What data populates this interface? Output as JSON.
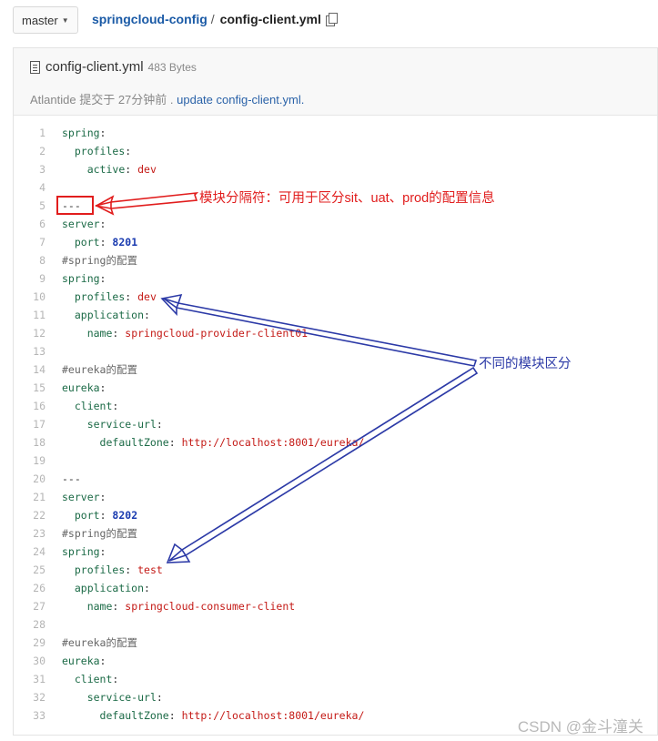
{
  "topbar": {
    "branch_label": "master",
    "repo_name": "springcloud-config",
    "separator": "/",
    "file_name": "config-client.yml"
  },
  "file_header": {
    "file_name": "config-client.yml",
    "file_size": "483 Bytes",
    "author": "Atlantide",
    "committed_text": "提交于 27分钟前 .",
    "commit_message": "update config-client.yml."
  },
  "code_lines": [
    {
      "n": "1",
      "parts": [
        {
          "t": "spring",
          "c": "k"
        },
        {
          "t": ":",
          "c": "p"
        }
      ]
    },
    {
      "n": "2",
      "parts": [
        {
          "t": "  ",
          "c": "p"
        },
        {
          "t": "profiles",
          "c": "k"
        },
        {
          "t": ":",
          "c": "p"
        }
      ]
    },
    {
      "n": "3",
      "parts": [
        {
          "t": "    ",
          "c": "p"
        },
        {
          "t": "active",
          "c": "k"
        },
        {
          "t": ": ",
          "c": "p"
        },
        {
          "t": "dev",
          "c": "v"
        }
      ]
    },
    {
      "n": "4",
      "parts": []
    },
    {
      "n": "5",
      "parts": [
        {
          "t": "---",
          "c": "p"
        }
      ]
    },
    {
      "n": "6",
      "parts": [
        {
          "t": "server",
          "c": "k"
        },
        {
          "t": ":",
          "c": "p"
        }
      ]
    },
    {
      "n": "7",
      "parts": [
        {
          "t": "  ",
          "c": "p"
        },
        {
          "t": "port",
          "c": "k"
        },
        {
          "t": ": ",
          "c": "p"
        },
        {
          "t": "8201",
          "c": "n"
        }
      ]
    },
    {
      "n": "8",
      "parts": [
        {
          "t": "#spring的配置",
          "c": "c"
        }
      ]
    },
    {
      "n": "9",
      "parts": [
        {
          "t": "spring",
          "c": "k"
        },
        {
          "t": ":",
          "c": "p"
        }
      ]
    },
    {
      "n": "10",
      "parts": [
        {
          "t": "  ",
          "c": "p"
        },
        {
          "t": "profiles",
          "c": "k"
        },
        {
          "t": ": ",
          "c": "p"
        },
        {
          "t": "dev",
          "c": "v"
        }
      ]
    },
    {
      "n": "11",
      "parts": [
        {
          "t": "  ",
          "c": "p"
        },
        {
          "t": "application",
          "c": "k"
        },
        {
          "t": ":",
          "c": "p"
        }
      ]
    },
    {
      "n": "12",
      "parts": [
        {
          "t": "    ",
          "c": "p"
        },
        {
          "t": "name",
          "c": "k"
        },
        {
          "t": ": ",
          "c": "p"
        },
        {
          "t": "springcloud-provider-client01",
          "c": "v"
        }
      ]
    },
    {
      "n": "13",
      "parts": []
    },
    {
      "n": "14",
      "parts": [
        {
          "t": "#eureka的配置",
          "c": "c"
        }
      ]
    },
    {
      "n": "15",
      "parts": [
        {
          "t": "eureka",
          "c": "k"
        },
        {
          "t": ":",
          "c": "p"
        }
      ]
    },
    {
      "n": "16",
      "parts": [
        {
          "t": "  ",
          "c": "p"
        },
        {
          "t": "client",
          "c": "k"
        },
        {
          "t": ":",
          "c": "p"
        }
      ]
    },
    {
      "n": "17",
      "parts": [
        {
          "t": "    ",
          "c": "p"
        },
        {
          "t": "service-url",
          "c": "k"
        },
        {
          "t": ":",
          "c": "p"
        }
      ]
    },
    {
      "n": "18",
      "parts": [
        {
          "t": "      ",
          "c": "p"
        },
        {
          "t": "defaultZone",
          "c": "k"
        },
        {
          "t": ": ",
          "c": "p"
        },
        {
          "t": "http://localhost:8001/eureka/",
          "c": "v"
        }
      ]
    },
    {
      "n": "19",
      "parts": []
    },
    {
      "n": "20",
      "parts": [
        {
          "t": "---",
          "c": "p"
        }
      ]
    },
    {
      "n": "21",
      "parts": [
        {
          "t": "server",
          "c": "k"
        },
        {
          "t": ":",
          "c": "p"
        }
      ]
    },
    {
      "n": "22",
      "parts": [
        {
          "t": "  ",
          "c": "p"
        },
        {
          "t": "port",
          "c": "k"
        },
        {
          "t": ": ",
          "c": "p"
        },
        {
          "t": "8202",
          "c": "n"
        }
      ]
    },
    {
      "n": "23",
      "parts": [
        {
          "t": "#spring的配置",
          "c": "c"
        }
      ]
    },
    {
      "n": "24",
      "parts": [
        {
          "t": "spring",
          "c": "k"
        },
        {
          "t": ":",
          "c": "p"
        }
      ]
    },
    {
      "n": "25",
      "parts": [
        {
          "t": "  ",
          "c": "p"
        },
        {
          "t": "profiles",
          "c": "k"
        },
        {
          "t": ": ",
          "c": "p"
        },
        {
          "t": "test",
          "c": "v"
        }
      ]
    },
    {
      "n": "26",
      "parts": [
        {
          "t": "  ",
          "c": "p"
        },
        {
          "t": "application",
          "c": "k"
        },
        {
          "t": ":",
          "c": "p"
        }
      ]
    },
    {
      "n": "27",
      "parts": [
        {
          "t": "    ",
          "c": "p"
        },
        {
          "t": "name",
          "c": "k"
        },
        {
          "t": ": ",
          "c": "p"
        },
        {
          "t": "springcloud-consumer-client",
          "c": "v"
        }
      ]
    },
    {
      "n": "28",
      "parts": []
    },
    {
      "n": "29",
      "parts": [
        {
          "t": "#eureka的配置",
          "c": "c"
        }
      ]
    },
    {
      "n": "30",
      "parts": [
        {
          "t": "eureka",
          "c": "k"
        },
        {
          "t": ":",
          "c": "p"
        }
      ]
    },
    {
      "n": "31",
      "parts": [
        {
          "t": "  ",
          "c": "p"
        },
        {
          "t": "client",
          "c": "k"
        },
        {
          "t": ":",
          "c": "p"
        }
      ]
    },
    {
      "n": "32",
      "parts": [
        {
          "t": "    ",
          "c": "p"
        },
        {
          "t": "service-url",
          "c": "k"
        },
        {
          "t": ":",
          "c": "p"
        }
      ]
    },
    {
      "n": "33",
      "parts": [
        {
          "t": "      ",
          "c": "p"
        },
        {
          "t": "defaultZone",
          "c": "k"
        },
        {
          "t": ": ",
          "c": "p"
        },
        {
          "t": "http://localhost:8001/eureka/",
          "c": "v"
        }
      ]
    }
  ],
  "annotations": {
    "separator_note": "模块分隔符：可用于区分sit、uat、prod的配置信息",
    "modules_note": "不同的模块区分"
  },
  "watermark": "CSDN @金斗潼关",
  "colors": {
    "annotation_red": "#e11d1d",
    "annotation_blue": "#2c3aa7",
    "link_blue": "#1a5aa6"
  }
}
